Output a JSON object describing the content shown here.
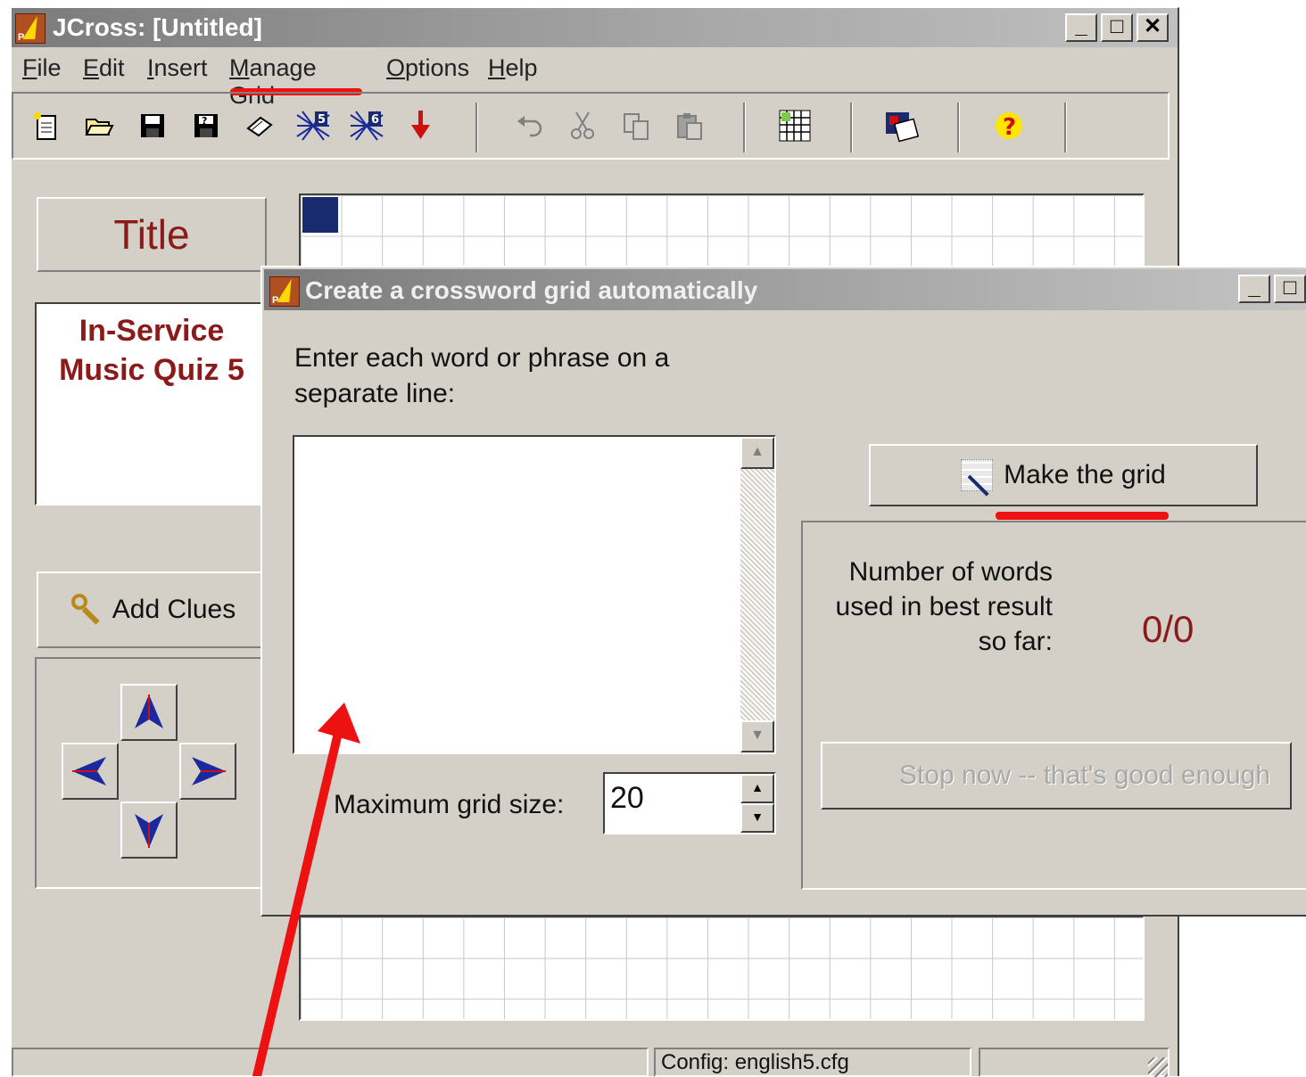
{
  "window": {
    "title": "JCross: [Untitled]",
    "icon_badge": "P",
    "controls": [
      "_",
      "□",
      "✕"
    ]
  },
  "menu": {
    "items": [
      {
        "pre": "",
        "ul": "F",
        "post": "ile"
      },
      {
        "pre": "",
        "ul": "E",
        "post": "dit"
      },
      {
        "pre": "",
        "ul": "I",
        "post": "nsert"
      },
      {
        "pre": "",
        "ul": "M",
        "post": "anage Grid"
      },
      {
        "pre": "",
        "ul": "O",
        "post": "ptions"
      },
      {
        "pre": "",
        "ul": "H",
        "post": "elp"
      }
    ]
  },
  "toolbar": {
    "icons": [
      "new-file-icon",
      "open-folder-icon",
      "save-icon",
      "save-as-icon",
      "eraser-icon",
      "grid-5-icon",
      "grid-6-icon",
      "export-icon",
      "undo-icon",
      "cut-icon",
      "copy-icon",
      "paste-icon",
      "make-grid-icon",
      "web-page-icon",
      "help-icon"
    ],
    "grid5": "5",
    "grid6": "6",
    "help": "?"
  },
  "left_panel": {
    "title": "Title",
    "quiz_title_line1": "In-Service",
    "quiz_title_line2": "Music Quiz 5",
    "add_clues": "Add Clues"
  },
  "status": {
    "config": "Config: english5.cfg"
  },
  "dialog": {
    "title": "Create a crossword grid automatically",
    "icon_badge": "P",
    "prompt": "Enter each word or phrase on a separate line:",
    "words_value": "",
    "max_label": "Maximum grid size:",
    "max_value": "20",
    "make_button": "Make the grid",
    "result_label": "Number of words used in best result so far:",
    "result_value": "0/0",
    "stop_button": "Stop now -- that's good enough"
  },
  "annotations": {
    "highlight_color": "#ee1111"
  }
}
